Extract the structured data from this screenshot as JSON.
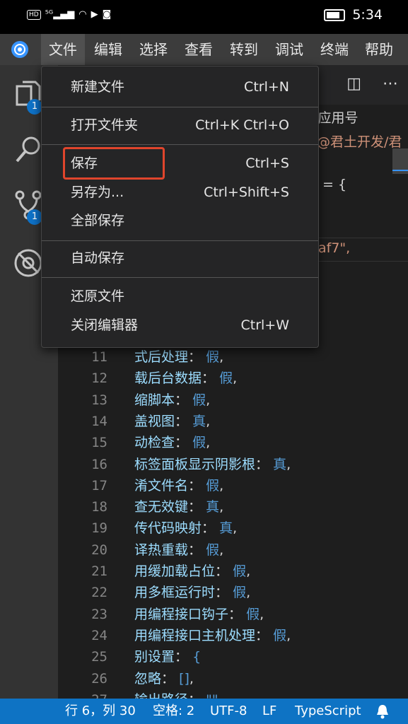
{
  "phone_status": {
    "time": "5:34",
    "network": "HD 5G"
  },
  "menubar": {
    "items": [
      "文件",
      "编辑",
      "选择",
      "查看",
      "转到",
      "调试",
      "终端",
      "帮助"
    ],
    "active_index": 0
  },
  "activity": {
    "explorer_badge": "1",
    "scm_badge": "1"
  },
  "breadcrumb": {
    "line1": "▸应用号",
    "line2": "@君土开发/君"
  },
  "code_fragments": {
    "eq_brace": "= {",
    "string": "af7\","
  },
  "code_lines": [
    {
      "num": "11",
      "key": "式后处理",
      "val": "假",
      "tail": ","
    },
    {
      "num": "12",
      "key": "载后台数据",
      "val": "假",
      "tail": ","
    },
    {
      "num": "13",
      "key": "缩脚本",
      "val": "假",
      "tail": ","
    },
    {
      "num": "14",
      "key": "盖视图",
      "val": "真",
      "tail": ","
    },
    {
      "num": "15",
      "key": "动检查",
      "val": "假",
      "tail": ","
    },
    {
      "num": "16",
      "key": "标签面板显示阴影根",
      "val": "真",
      "tail": ","
    },
    {
      "num": "17",
      "key": "淆文件名",
      "val": "假",
      "tail": ","
    },
    {
      "num": "18",
      "key": "查无效键",
      "val": "真",
      "tail": ","
    },
    {
      "num": "19",
      "key": "传代码映射",
      "val": "真",
      "tail": ","
    },
    {
      "num": "20",
      "key": "译热重载",
      "val": "假",
      "tail": ","
    },
    {
      "num": "21",
      "key": "用缓加载占位",
      "val": "假",
      "tail": ","
    },
    {
      "num": "22",
      "key": "用多框运行时",
      "val": "假",
      "tail": ","
    },
    {
      "num": "23",
      "key": "用编程接口钩子",
      "val": "假",
      "tail": ","
    },
    {
      "num": "24",
      "key": "用编程接口主机处理",
      "val": "假",
      "tail": ","
    },
    {
      "num": "25",
      "key": "别设置",
      "val": "{",
      "tail": ""
    },
    {
      "num": "26",
      "key": " 忽略",
      "val": "[]",
      "tail": ","
    },
    {
      "num": "27",
      "key": " 输出路径",
      "val": "\"\"",
      "tail": ""
    }
  ],
  "dropdown": {
    "items": [
      {
        "label": "新建文件",
        "shortcut": "Ctrl+N"
      },
      {
        "label": "打开文件夹",
        "shortcut": "Ctrl+K Ctrl+O"
      },
      {
        "label": "保存",
        "shortcut": "Ctrl+S"
      },
      {
        "label": "另存为...",
        "shortcut": "Ctrl+Shift+S"
      },
      {
        "label": "全部保存",
        "shortcut": ""
      },
      {
        "label": "自动保存",
        "shortcut": ""
      },
      {
        "label": "还原文件",
        "shortcut": ""
      },
      {
        "label": "关闭编辑器",
        "shortcut": "Ctrl+W"
      }
    ]
  },
  "statusbar": {
    "position": "行 6，列 30",
    "indent": "空格: 2",
    "encoding": "UTF-8",
    "eol": "LF",
    "language": "TypeScript"
  },
  "colors": {
    "accent": "#0e73c4",
    "highlight": "#e0452c"
  }
}
